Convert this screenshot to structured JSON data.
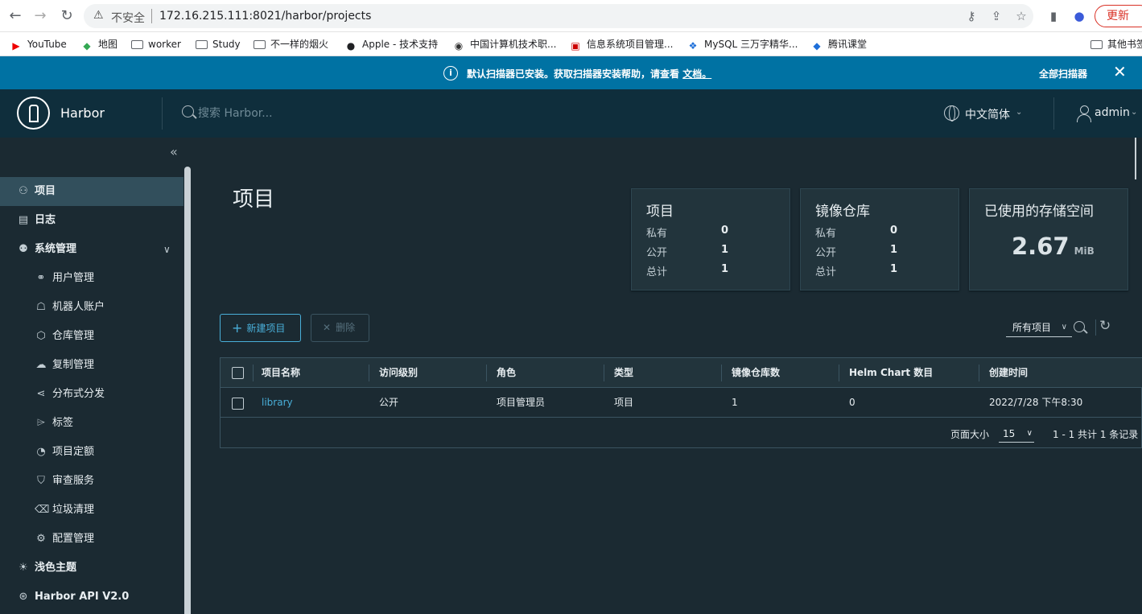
{
  "browser": {
    "back": "←",
    "forward": "→",
    "reload": "↻",
    "insecure_label": "不安全",
    "url": "172.16.215.111:8021/harbor/projects",
    "update_label": "更新"
  },
  "bookmarks": [
    {
      "label": "YouTube",
      "icon": "youtube-icon"
    },
    {
      "label": "地图",
      "icon": "maps-icon"
    },
    {
      "label": "worker",
      "icon": "folder-icon"
    },
    {
      "label": "Study",
      "icon": "folder-icon"
    },
    {
      "label": "不一样的烟火",
      "icon": "folder-icon"
    },
    {
      "label": "Apple - 技术支持",
      "icon": "apple-icon"
    },
    {
      "label": "中国计算机技术职...",
      "icon": "site-icon"
    },
    {
      "label": "信息系统项目管理...",
      "icon": "site-icon"
    },
    {
      "label": "MySQL 三万字精华...",
      "icon": "site-icon"
    },
    {
      "label": "腾讯课堂",
      "icon": "site-icon"
    },
    {
      "label": "其他书签",
      "icon": "folder-icon"
    }
  ],
  "banner": {
    "text": "默认扫描器已安装。获取扫描器安装帮助，请查看",
    "link": "文档。",
    "action": "全部扫描器",
    "close": "✕"
  },
  "header": {
    "app_name": "Harbor",
    "search_placeholder": "搜索 Harbor...",
    "language": "中文简体",
    "user": "admin"
  },
  "sidebar": {
    "collapse": "«",
    "items": [
      {
        "label": "项目",
        "icon": "projects-icon"
      },
      {
        "label": "日志",
        "icon": "logs-icon"
      },
      {
        "label": "系统管理",
        "icon": "admin-icon"
      },
      {
        "label": "用户管理",
        "icon": "users-icon"
      },
      {
        "label": "机器人账户",
        "icon": "robot-icon"
      },
      {
        "label": "仓库管理",
        "icon": "registry-icon"
      },
      {
        "label": "复制管理",
        "icon": "replication-icon"
      },
      {
        "label": "分布式分发",
        "icon": "share-icon"
      },
      {
        "label": "标签",
        "icon": "tag-icon"
      },
      {
        "label": "项目定额",
        "icon": "quota-icon"
      },
      {
        "label": "审查服务",
        "icon": "shield-icon"
      },
      {
        "label": "垃圾清理",
        "icon": "trash-icon"
      },
      {
        "label": "配置管理",
        "icon": "gear-icon"
      },
      {
        "label": "浅色主题",
        "icon": "sun-icon"
      },
      {
        "label": "Harbor API V2.0",
        "icon": "api-icon"
      }
    ]
  },
  "main": {
    "title": "项目",
    "cards": [
      {
        "title": "项目",
        "rows": [
          {
            "label": "私有",
            "value": "0"
          },
          {
            "label": "公开",
            "value": "1"
          },
          {
            "label": "总计",
            "value": "1"
          }
        ]
      },
      {
        "title": "镜像仓库",
        "rows": [
          {
            "label": "私有",
            "value": "0"
          },
          {
            "label": "公开",
            "value": "1"
          },
          {
            "label": "总计",
            "value": "1"
          }
        ]
      }
    ],
    "storage": {
      "title": "已使用的存储空间",
      "value": "2.67",
      "unit": "MiB"
    },
    "new_button": "新建项目",
    "delete_button": "删除",
    "filter": "所有项目",
    "columns": [
      "项目名称",
      "访问级别",
      "角色",
      "类型",
      "镜像仓库数",
      "Helm Chart 数目",
      "创建时间"
    ],
    "rows": [
      {
        "name": "library",
        "access": "公开",
        "role": "项目管理员",
        "type": "项目",
        "repo_count": "1",
        "chart_count": "0",
        "created": "2022/7/28 下午8:30"
      }
    ],
    "footer": {
      "page_size_label": "页面大小",
      "page_size": "15",
      "count_text": "1 - 1 共计 1 条记录"
    }
  }
}
